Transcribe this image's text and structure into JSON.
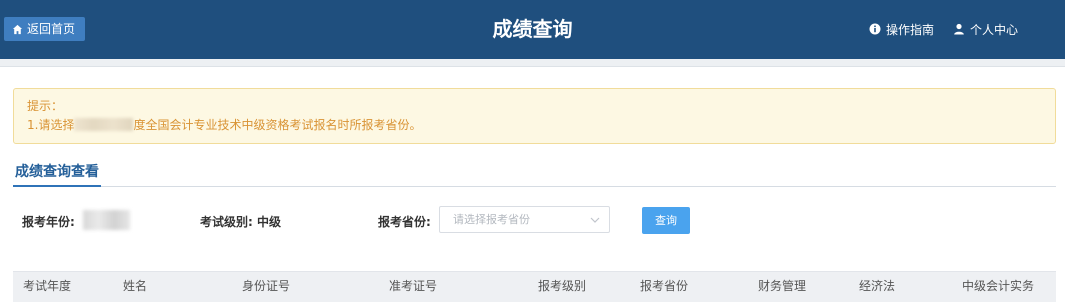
{
  "header": {
    "home_label": "返回首页",
    "title": "成绩查询",
    "guide_label": "操作指南",
    "center_label": "个人中心"
  },
  "notice": {
    "heading": "提示：",
    "line1_prefix": "1.请选择",
    "line1_suffix": "度全国会计专业技术中级资格考试报名时所报考省份。"
  },
  "tabs": [
    {
      "label": "成绩查询查看",
      "active": true
    }
  ],
  "form": {
    "year_label": "报考年份:",
    "level_text": "考试级别: 中级",
    "province_label": "报考省份:",
    "province_placeholder": "请选择报考省份",
    "query_label": "查询"
  },
  "table": {
    "columns": [
      "考试年度",
      "姓名",
      "身份证号",
      "准考证号",
      "报考级别",
      "报考省份",
      "财务管理",
      "经济法",
      "中级会计实务"
    ]
  },
  "colors": {
    "header_bg": "#1f4f7e",
    "home_btn": "#3f7ec0",
    "notice_text": "#d99334",
    "query_btn": "#4aa3ee"
  }
}
